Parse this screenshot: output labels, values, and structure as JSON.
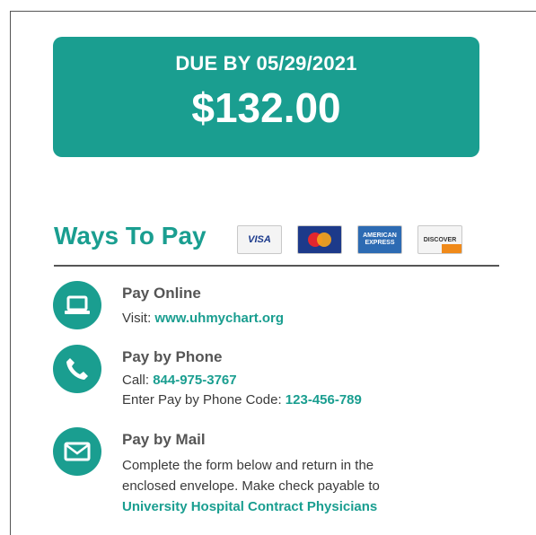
{
  "due": {
    "label": "DUE BY 05/29/2021",
    "amount": "$132.00"
  },
  "ways": {
    "title": "Ways To Pay",
    "cards": [
      {
        "name": "visa",
        "label": "VISA"
      },
      {
        "name": "mastercard",
        "label": ""
      },
      {
        "name": "american-express",
        "label": "AMERICAN EXPRESS"
      },
      {
        "name": "discover",
        "label": "DISCOVER"
      }
    ]
  },
  "methods": {
    "online": {
      "title": "Pay Online",
      "visit_label": "Visit:",
      "url": "www.uhmychart.org",
      "icon": "laptop-icon"
    },
    "phone": {
      "title": "Pay by Phone",
      "call_label": "Call:",
      "phone": "844-975-3767",
      "code_label": "Enter Pay by Phone Code:",
      "code": "123-456-789",
      "icon": "phone-icon"
    },
    "mail": {
      "title": "Pay by Mail",
      "line1": "Complete the form below and return in the",
      "line2": "enclosed envelope. Make check payable to",
      "payee": "University Hospital Contract Physicians",
      "icon": "envelope-icon"
    }
  },
  "colors": {
    "accent": "#1a9e90",
    "text": "#3a3a3a"
  }
}
